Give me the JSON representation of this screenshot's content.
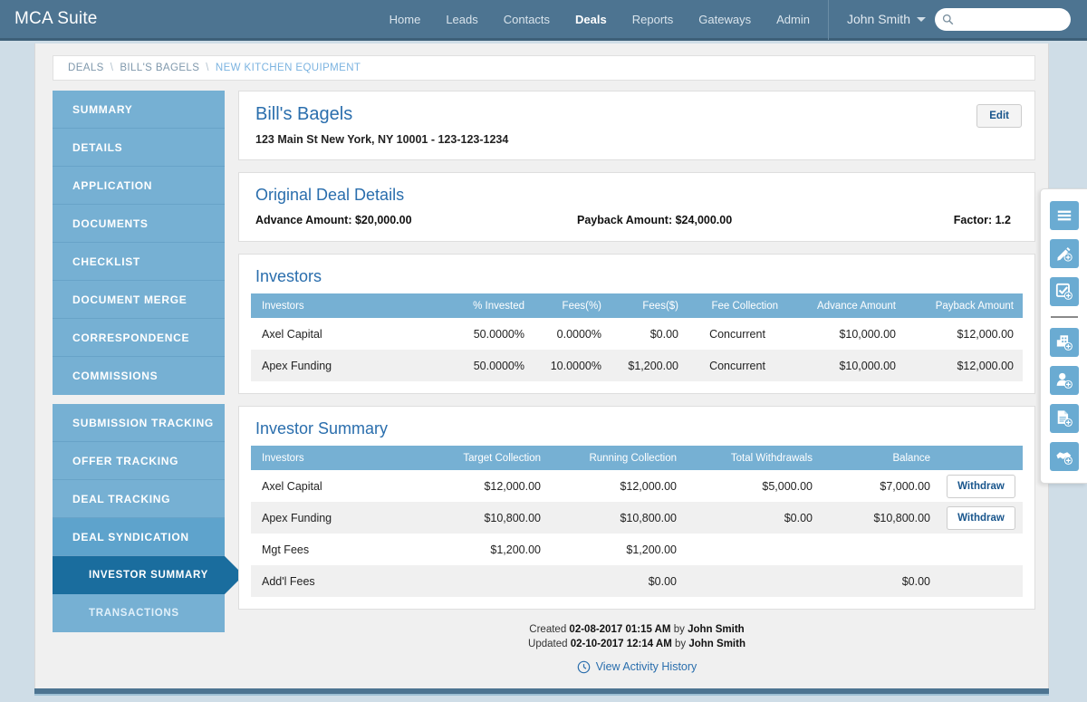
{
  "app": {
    "brand": "MCA Suite",
    "nav": [
      {
        "label": "Home",
        "active": false
      },
      {
        "label": "Leads",
        "active": false
      },
      {
        "label": "Contacts",
        "active": false
      },
      {
        "label": "Deals",
        "active": true
      },
      {
        "label": "Reports",
        "active": false
      },
      {
        "label": "Gateways",
        "active": false
      },
      {
        "label": "Admin",
        "active": false
      }
    ],
    "user": "John Smith",
    "search_placeholder": "",
    "search_value": ""
  },
  "breadcrumb": {
    "items": [
      "DEALS",
      "BILL'S BAGELS",
      "NEW KITCHEN EQUIPMENT"
    ],
    "separator": "\\"
  },
  "sidebar": {
    "group1": [
      {
        "label": "SUMMARY"
      },
      {
        "label": "DETAILS"
      },
      {
        "label": "APPLICATION"
      },
      {
        "label": "DOCUMENTS"
      },
      {
        "label": "CHECKLIST"
      },
      {
        "label": "DOCUMENT MERGE"
      },
      {
        "label": "CORRESPONDENCE"
      },
      {
        "label": "COMMISSIONS"
      }
    ],
    "group2": [
      {
        "label": "SUBMISSION TRACKING"
      },
      {
        "label": "OFFER TRACKING"
      },
      {
        "label": "DEAL TRACKING"
      },
      {
        "label": "DEAL SYNDICATION"
      },
      {
        "label": "INVESTOR SUMMARY"
      },
      {
        "label": "TRANSACTIONS"
      }
    ]
  },
  "deal_header": {
    "title": "Bill's Bagels",
    "address": "123 Main St New York, NY 10001 - 123-123-1234",
    "edit_label": "Edit"
  },
  "original_deal": {
    "title": "Original Deal Details",
    "advance_label": "Advance Amount:",
    "advance_value": "$20,000.00",
    "payback_label": "Payback Amount:",
    "payback_value": "$24,000.00",
    "factor_label": "Factor:",
    "factor_value": "1.2"
  },
  "investors": {
    "title": "Investors",
    "columns": [
      "Investors",
      "% Invested",
      "Fees(%)",
      "Fees($)",
      "Fee Collection",
      "Advance Amount",
      "Payback Amount"
    ],
    "rows": [
      [
        "Axel Capital",
        "50.0000%",
        "0.0000%",
        "$0.00",
        "Concurrent",
        "$10,000.00",
        "$12,000.00"
      ],
      [
        "Apex Funding",
        "50.0000%",
        "10.0000%",
        "$1,200.00",
        "Concurrent",
        "$10,000.00",
        "$12,000.00"
      ]
    ]
  },
  "investor_summary": {
    "title": "Investor Summary",
    "columns": [
      "Investors",
      "Target Collection",
      "Running Collection",
      "Total Withdrawals",
      "Balance",
      ""
    ],
    "rows": [
      {
        "cells": [
          "Axel Capital",
          "$12,000.00",
          "$12,000.00",
          "$5,000.00",
          "$7,000.00"
        ],
        "action": "Withdraw"
      },
      {
        "cells": [
          "Apex Funding",
          "$10,800.00",
          "$10,800.00",
          "$0.00",
          "$10,800.00"
        ],
        "action": "Withdraw"
      },
      {
        "cells": [
          "Mgt Fees",
          "$1,200.00",
          "$1,200.00",
          "",
          ""
        ],
        "action": ""
      },
      {
        "cells": [
          "Add'l Fees",
          "",
          "$0.00",
          "",
          "$0.00"
        ],
        "action": ""
      }
    ]
  },
  "meta": {
    "created_prefix": "Created",
    "created_date": "02-08-2017 01:15 AM",
    "created_by_prefix": "by",
    "created_by": "John Smith",
    "updated_prefix": "Updated",
    "updated_date": "02-10-2017 12:14 AM",
    "updated_by_prefix": "by",
    "updated_by": "John Smith",
    "activity_link": "View Activity History"
  },
  "toolbar": {
    "items": [
      {
        "icon": "list-icon",
        "name": "notes-list-button"
      },
      {
        "icon": "pencil-plus-icon",
        "name": "add-note-button"
      },
      {
        "icon": "checkbox-plus-icon",
        "name": "add-task-button"
      },
      {
        "icon": "building-plus-icon",
        "name": "add-company-button"
      },
      {
        "icon": "person-plus-icon",
        "name": "add-contact-button"
      },
      {
        "icon": "document-plus-icon",
        "name": "add-document-button"
      },
      {
        "icon": "handshake-plus-icon",
        "name": "add-deal-button"
      }
    ]
  },
  "colors": {
    "navbar": "#4d7491",
    "accent_blue": "#2a6ead",
    "table_header": "#76b0d3",
    "sidebar": "#76b0d3",
    "sidebar_active": "#1a6d9e",
    "page_bg": "#cfdde7"
  }
}
